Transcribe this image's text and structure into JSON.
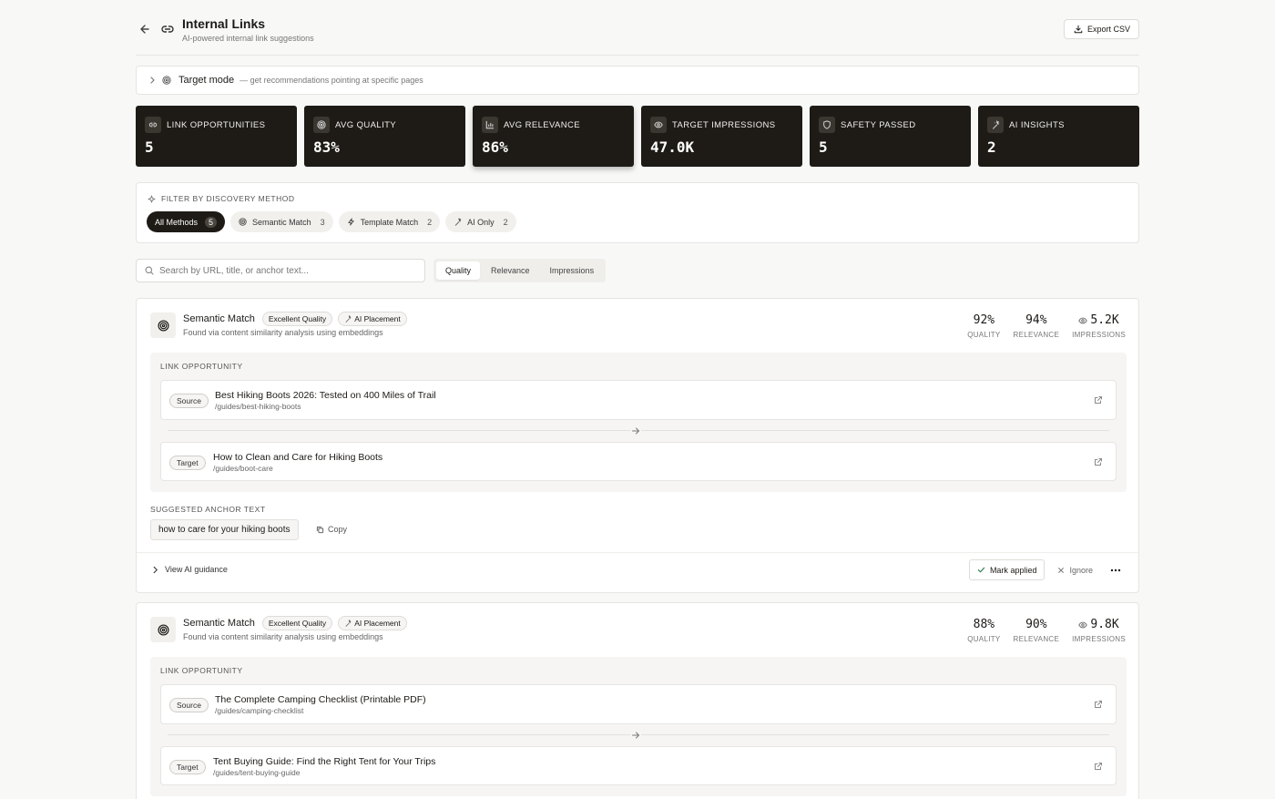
{
  "header": {
    "title": "Internal Links",
    "subtitle": "AI-powered internal link suggestions",
    "export_label": "Export CSV"
  },
  "target_mode": {
    "label": "Target mode",
    "description": "— get recommendations pointing at specific pages"
  },
  "stats": [
    {
      "label": "LINK OPPORTUNITIES",
      "value": "5",
      "icon": "link-icon"
    },
    {
      "label": "AVG QUALITY",
      "value": "83%",
      "icon": "target-icon"
    },
    {
      "label": "AVG RELEVANCE",
      "value": "86%",
      "icon": "bar-chart-icon"
    },
    {
      "label": "TARGET IMPRESSIONS",
      "value": "47.0K",
      "icon": "eye-icon"
    },
    {
      "label": "SAFETY PASSED",
      "value": "5",
      "icon": "shield-icon"
    },
    {
      "label": "AI INSIGHTS",
      "value": "2",
      "icon": "sparkles-icon"
    }
  ],
  "filter": {
    "title": "FILTER BY DISCOVERY METHOD",
    "chips": [
      {
        "label": "All Methods",
        "count": "5",
        "active": true
      },
      {
        "label": "Semantic Match",
        "count": "3",
        "icon": "target-icon"
      },
      {
        "label": "Template Match",
        "count": "2",
        "icon": "zap-icon"
      },
      {
        "label": "AI Only",
        "count": "2",
        "icon": "sparkles-icon"
      }
    ]
  },
  "search": {
    "placeholder": "Search by URL, title, or anchor text...",
    "value": ""
  },
  "sort": {
    "tabs": [
      "Quality",
      "Relevance",
      "Impressions"
    ],
    "active": "Quality"
  },
  "cards": [
    {
      "method": "Semantic Match",
      "badge_quality": "Excellent Quality",
      "badge_ai": "AI Placement",
      "description": "Found via content similarity analysis using embeddings",
      "quality": "92%",
      "quality_label": "QUALITY",
      "relevance": "94%",
      "relevance_label": "RELEVANCE",
      "impressions": "5.2K",
      "impressions_label": "IMPRESSIONS",
      "opportunity_title": "LINK OPPORTUNITY",
      "source_tag": "Source",
      "source_title": "Best Hiking Boots 2026: Tested on 400 Miles of Trail",
      "source_path": "/guides/best-hiking-boots",
      "target_tag": "Target",
      "target_title": "How to Clean and Care for Hiking Boots",
      "target_path": "/guides/boot-care",
      "anchor_title": "SUGGESTED ANCHOR TEXT",
      "anchor_text": "how to care for your hiking boots",
      "copy_label": "Copy",
      "ai_guidance_label": "View AI guidance",
      "mark_applied_label": "Mark applied",
      "ignore_label": "Ignore"
    },
    {
      "method": "Semantic Match",
      "badge_quality": "Excellent Quality",
      "badge_ai": "AI Placement",
      "description": "Found via content similarity analysis using embeddings",
      "quality": "88%",
      "quality_label": "QUALITY",
      "relevance": "90%",
      "relevance_label": "RELEVANCE",
      "impressions": "9.8K",
      "impressions_label": "IMPRESSIONS",
      "opportunity_title": "LINK OPPORTUNITY",
      "source_tag": "Source",
      "source_title": "The Complete Camping Checklist (Printable PDF)",
      "source_path": "/guides/camping-checklist",
      "target_tag": "Target",
      "target_title": "Tent Buying Guide: Find the Right Tent for Your Trips",
      "target_path": "/guides/tent-buying-guide"
    }
  ]
}
